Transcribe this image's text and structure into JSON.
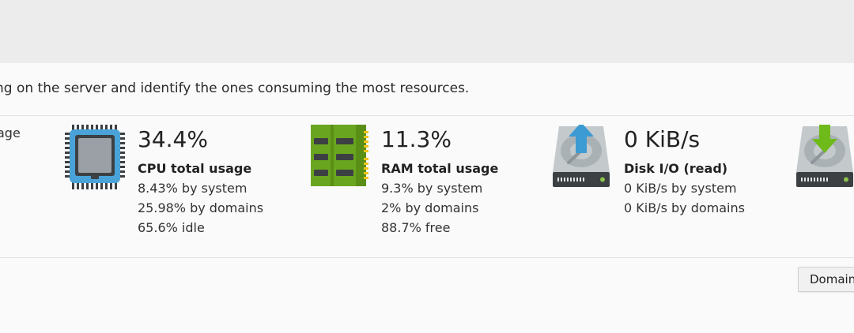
{
  "header": {
    "description": "ng on the server and identify the ones consuming the most resources."
  },
  "sidebar_fragment": {
    "label": "age"
  },
  "stats": {
    "cpu": {
      "icon": "cpu-chip-icon",
      "value": "34.4%",
      "title": "CPU total usage",
      "lines": [
        "8.43% by system",
        "25.98% by domains",
        "65.6% idle"
      ]
    },
    "ram": {
      "icon": "ram-module-icon",
      "value": "11.3%",
      "title": "RAM total usage",
      "lines": [
        "9.3% by system",
        "2% by domains",
        "88.7% free"
      ]
    },
    "disk_read": {
      "icon": "disk-read-icon",
      "value": "0 KiB/s",
      "title": "Disk I/O (read)",
      "lines": [
        "0 KiB/s by system",
        "0 KiB/s by domains"
      ]
    },
    "disk_write": {
      "icon": "disk-write-icon"
    }
  },
  "actions": {
    "domains_button": "Domains"
  },
  "colors": {
    "cpu_blue": "#4aa3d8",
    "ram_green": "#6aa51f",
    "arrow_up": "#3d9bd4",
    "arrow_down": "#6fba1b",
    "disk_gray": "#b0b6ba"
  }
}
